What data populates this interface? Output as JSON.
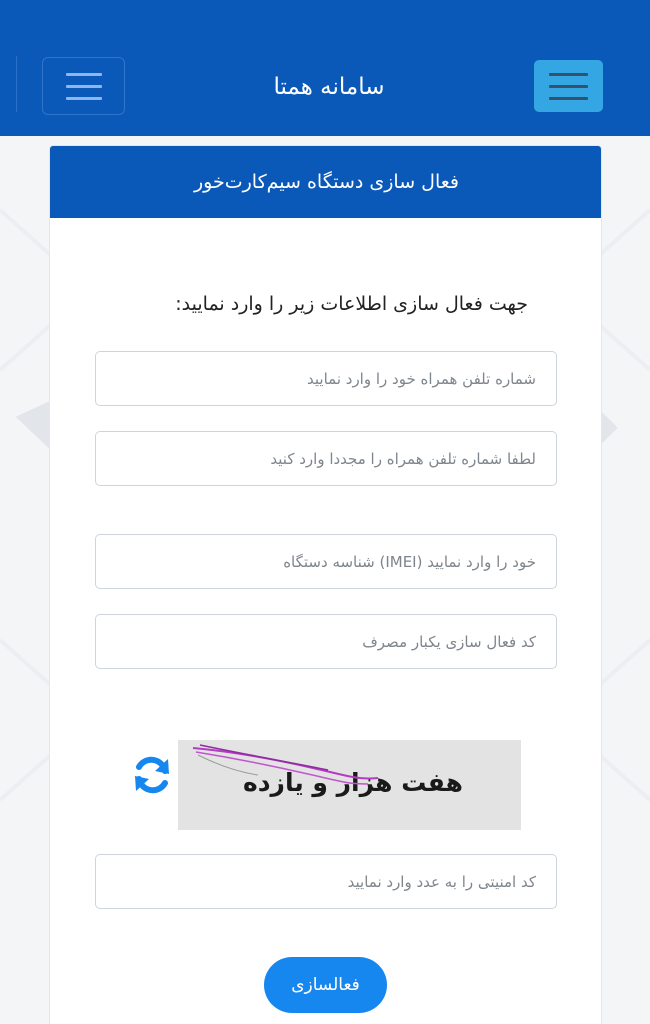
{
  "header": {
    "brand": "سامانه همتا"
  },
  "card": {
    "title": "فعال سازی دستگاه سیم‌کارت‌خور",
    "instruction": "جهت فعال سازی اطلاعات زیر را وارد نمایید:"
  },
  "form": {
    "phone_placeholder": "شماره تلفن همراه خود را وارد نمایید",
    "phone_confirm_placeholder": "لطفا شماره تلفن همراه را مجددا وارد کنید",
    "imei_placeholder": "خود را وارد نمایید (IMEI) شناسه دستگاه",
    "otp_placeholder": "کد فعال سازی یکبار مصرف",
    "captcha_placeholder": "کد امنیتی را به عدد وارد نمایید",
    "captcha_text": "هفت هزار و یازده",
    "submit_label": "فعالسازی"
  },
  "colors": {
    "primary": "#0a59b8",
    "button": "#1787f0",
    "refresh_icon": "#1787f0"
  },
  "icons": {
    "menu_left": "hamburger-icon",
    "menu_right": "hamburger-icon",
    "refresh": "refresh-icon"
  }
}
